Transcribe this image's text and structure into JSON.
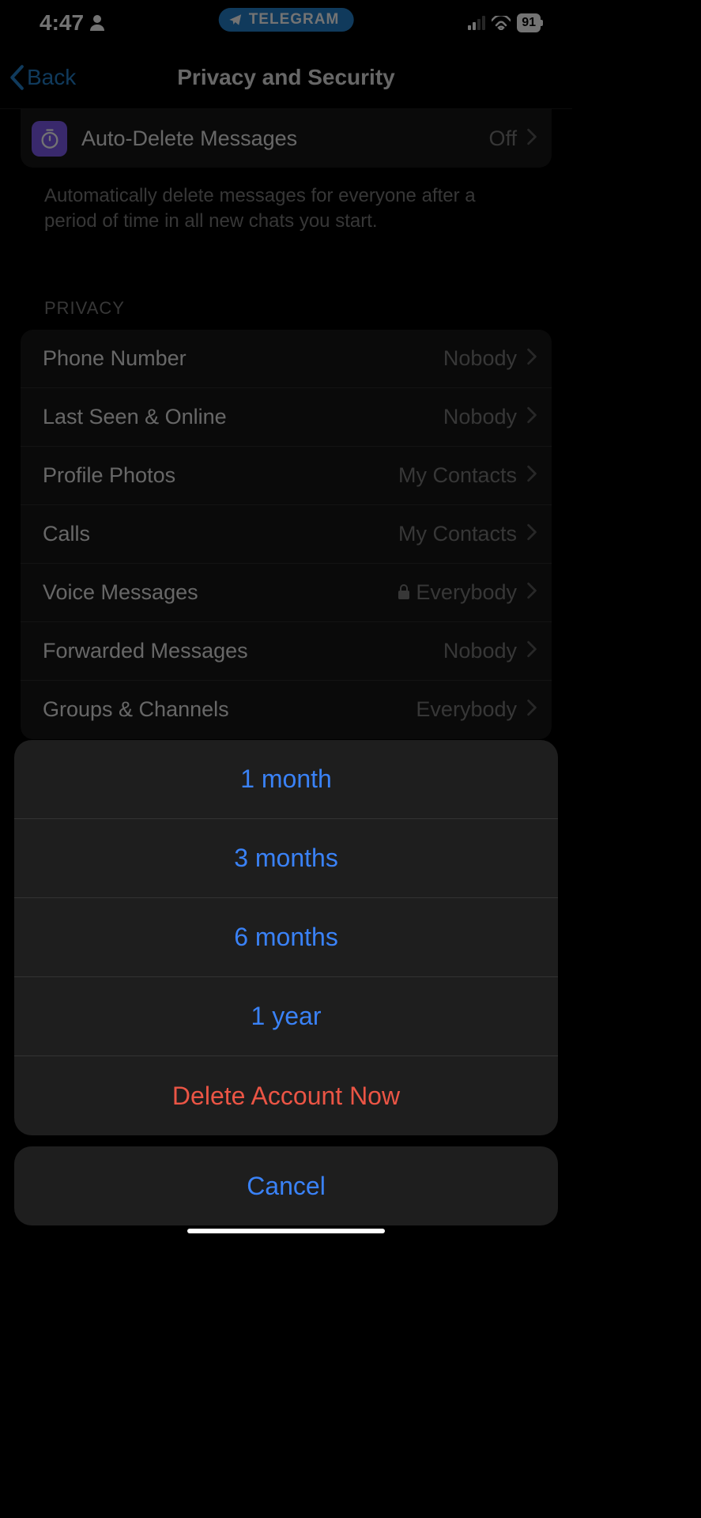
{
  "status": {
    "time": "4:47",
    "app_pill": "TELEGRAM",
    "battery": "91"
  },
  "nav": {
    "back_label": "Back",
    "title": "Privacy and Security"
  },
  "auto_delete": {
    "label": "Auto-Delete Messages",
    "value": "Off",
    "footer": "Automatically delete messages for everyone after a period of time in all new chats you start."
  },
  "privacy_section": {
    "title": "PRIVACY",
    "items": [
      {
        "label": "Phone Number",
        "value": "Nobody",
        "locked": false
      },
      {
        "label": "Last Seen & Online",
        "value": "Nobody",
        "locked": false
      },
      {
        "label": "Profile Photos",
        "value": "My Contacts",
        "locked": false
      },
      {
        "label": "Calls",
        "value": "My Contacts",
        "locked": false
      },
      {
        "label": "Voice Messages",
        "value": "Everybody",
        "locked": true
      },
      {
        "label": "Forwarded Messages",
        "value": "Nobody",
        "locked": false
      },
      {
        "label": "Groups & Channels",
        "value": "Everybody",
        "locked": false
      }
    ]
  },
  "action_sheet": {
    "options": [
      "1 month",
      "3 months",
      "6 months",
      "1 year"
    ],
    "destructive": "Delete Account Now",
    "cancel": "Cancel"
  }
}
